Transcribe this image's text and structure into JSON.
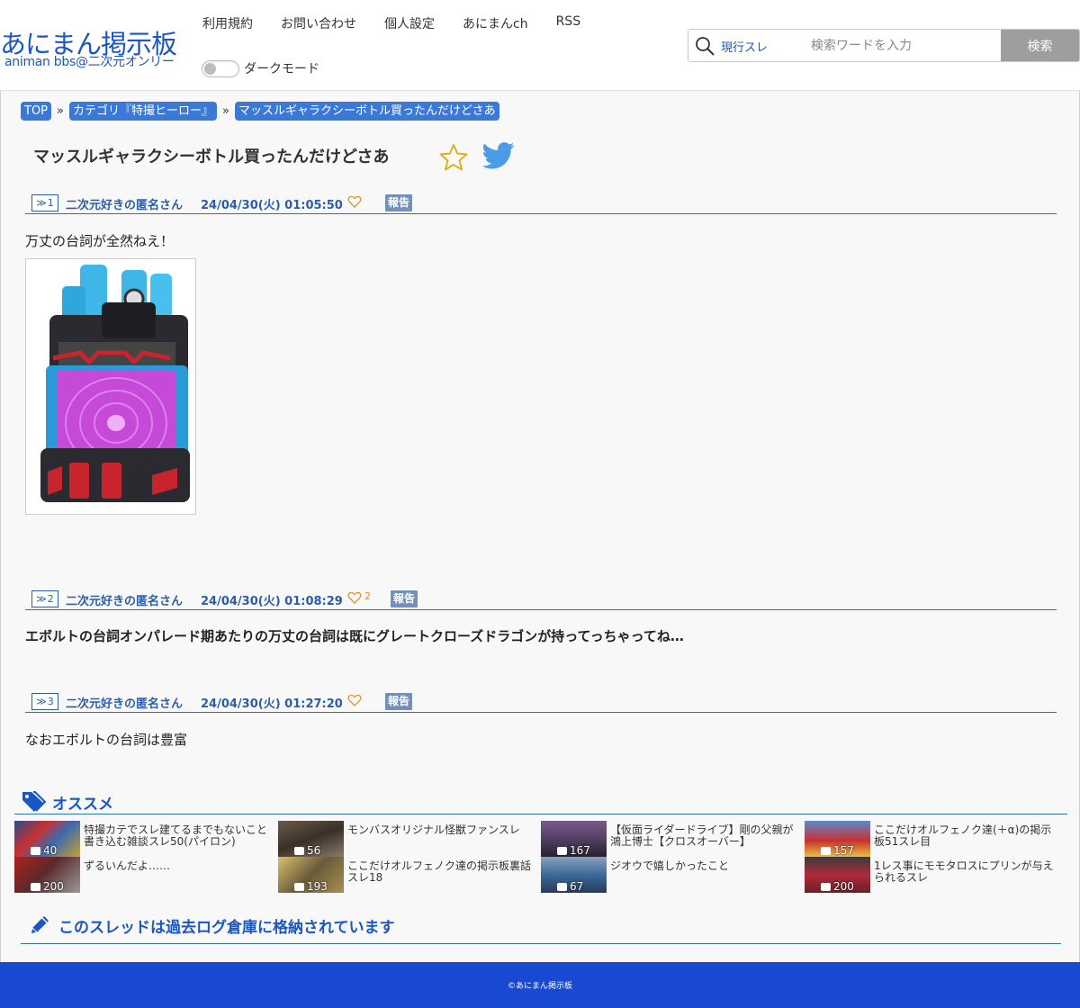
{
  "site": {
    "logo": "あにまん掲示板",
    "logo_sub": "animan bbs@二次元オンリー"
  },
  "nav": {
    "items": [
      "利用規約",
      "お問い合わせ",
      "個人設定",
      "あにまんch",
      "RSS"
    ]
  },
  "dark_mode": {
    "label": "ダークモード",
    "on": false
  },
  "search": {
    "scope": "現行スレ",
    "placeholder": "検索ワードを入力",
    "button": "検索"
  },
  "breadcrumbs": [
    "TOP",
    "カテゴリ『特撮ヒーロー』",
    "マッスルギャラクシーボトル買ったんだけどさあ"
  ],
  "thread": {
    "title": "マッスルギャラクシーボトル買ったんだけどさあ"
  },
  "posts": [
    {
      "num": "1",
      "name": "二次元好きの匿名さん",
      "date": "24/04/30(火) 01:05:50",
      "likes": "",
      "report": "報告",
      "body": "万丈の台詞が全然ねえ！",
      "has_image": true
    },
    {
      "num": "2",
      "name": "二次元好きの匿名さん",
      "date": "24/04/30(火) 01:08:29",
      "likes": "2",
      "report": "報告",
      "body": "エボルトの台詞オンパレード期あたりの万丈の台詞は既にグレートクローズドラゴンが持ってっちゃってね…",
      "has_image": false
    },
    {
      "num": "3",
      "name": "二次元好きの匿名さん",
      "date": "24/04/30(火) 01:27:20",
      "likes": "",
      "report": "報告",
      "body": "なおエボルトの台詞は豊富",
      "has_image": false
    }
  ],
  "recommend": {
    "title": "オススメ",
    "items": [
      {
        "title": "特撮カテでスレ建てるまでもないこと書き込む雑談スレ50(パイロン)",
        "count": "40",
        "color": "#3a5d9a"
      },
      {
        "title": "モンバスオリジナル怪獣ファンスレ",
        "count": "56",
        "color": "#5a4a3a"
      },
      {
        "title": "【仮面ライダードライブ】剛の父親が鴻上博士【クロスオーバー】",
        "count": "167",
        "color": "#4a3a5a"
      },
      {
        "title": "ここだけオルフェノク達(＋α)の掲示板51スレ目",
        "count": "157",
        "color": "#3a6ab0"
      },
      {
        "title": "ずるいんだよ……",
        "count": "200",
        "color": "#7a2a2a"
      },
      {
        "title": "ここだけオルフェノク達の掲示板裏話スレ18",
        "count": "193",
        "color": "#8a7a4a"
      },
      {
        "title": "ジオウで嬉しかったこと",
        "count": "67",
        "color": "#4a6a8a"
      },
      {
        "title": "1レス事にモモタロスにプリンが与えられるスレ",
        "count": "200",
        "color": "#8a2a3a"
      }
    ]
  },
  "archive_notice": "このスレッドは過去ログ倉庫に格納されています",
  "footer": "©あにまん掲示板",
  "colors": {
    "accent": "#1a56c4",
    "footer_bg": "#1a49d1",
    "crumb_bg": "#3b79d8",
    "report_bg": "#7590b8"
  }
}
